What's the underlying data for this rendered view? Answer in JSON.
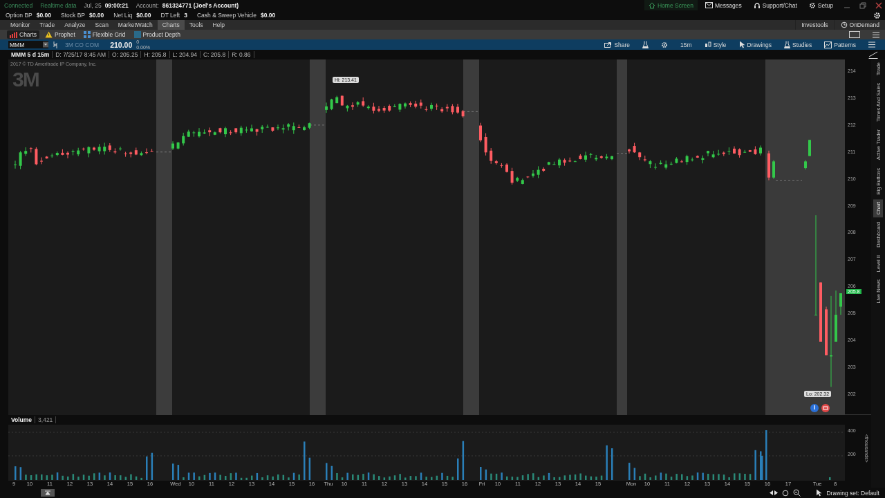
{
  "status_bar": {
    "connection": "Connected",
    "data_feed": "Realtime data",
    "date": "Jul, 25",
    "time": "09:00:21",
    "account_label": "Account:",
    "account": "861324771 (Joel's Account)"
  },
  "top_links": [
    {
      "label": "Home Screen",
      "kind": "home"
    },
    {
      "label": "Messages",
      "kind": "mail"
    },
    {
      "label": "Support/Chat",
      "kind": "headset"
    },
    {
      "label": "Setup",
      "kind": "gear"
    }
  ],
  "balances": [
    {
      "label": "Option BP",
      "value": "$0.00"
    },
    {
      "label": "Stock BP",
      "value": "$0.00"
    },
    {
      "label": "Net Liq",
      "value": "$0.00"
    },
    {
      "label": "DT Left",
      "value": "3"
    },
    {
      "label": "Cash & Sweep Vehicle",
      "value": "$0.00"
    }
  ],
  "main_tabs": [
    {
      "label": "Monitor",
      "selected": false
    },
    {
      "label": "Trade",
      "selected": false
    },
    {
      "label": "Analyze",
      "selected": false
    },
    {
      "label": "Scan",
      "selected": false
    },
    {
      "label": "MarketWatch",
      "selected": false
    },
    {
      "label": "Charts",
      "selected": true
    },
    {
      "label": "Tools",
      "selected": false
    },
    {
      "label": "Help",
      "selected": false
    }
  ],
  "right_links": [
    {
      "label": "Investools",
      "kind": "plain"
    },
    {
      "label": "OnDemand",
      "kind": "clock"
    }
  ],
  "sub_tabs": [
    {
      "label": "Charts",
      "kind": "bars",
      "selected": true
    },
    {
      "label": "Prophet",
      "kind": "warning",
      "selected": false
    },
    {
      "label": "Flexible Grid",
      "kind": "grid",
      "selected": false
    },
    {
      "label": "Product Depth",
      "kind": "depth",
      "selected": false
    }
  ],
  "symbol_bar": {
    "symbol": "MMM",
    "description": "3M CO COM",
    "last": "210.00",
    "change": "0",
    "change_pct": "0.00%"
  },
  "chart_tools": [
    {
      "label": "Share",
      "kind": "share"
    },
    {
      "kind": "flask"
    },
    {
      "kind": "gear"
    },
    {
      "label": "15m",
      "kind": "text"
    },
    {
      "label": "Style",
      "kind": "style"
    },
    {
      "label": "Drawings",
      "kind": "cursor"
    },
    {
      "label": "Studies",
      "kind": "flask"
    },
    {
      "label": "Patterns",
      "kind": "patterns"
    },
    {
      "kind": "menu"
    }
  ],
  "chart_header": {
    "title": "MMM 5 d 15m",
    "fields": [
      "D: 7/25/17 8:45 AM",
      "O: 205.25",
      "H: 205.8",
      "L: 204.94",
      "C: 205.8",
      "R: 0.86"
    ]
  },
  "price_chart": {
    "watermark": "2017 © TD Ameritrade IP Company, Inc.",
    "logo": "3M",
    "high_label": "Hi: 213.41",
    "low_label": "Lo: 202.32",
    "last_price": "205.8",
    "price_axis": [
      "214",
      "213",
      "212",
      "211",
      "210",
      "209",
      "208",
      "207",
      "206",
      "205",
      "204",
      "203",
      "202"
    ]
  },
  "side_tabs": [
    {
      "label": "Trade",
      "selected": false
    },
    {
      "label": "Times And Sales",
      "selected": false
    },
    {
      "label": "Active Trader",
      "selected": false
    },
    {
      "label": "Big Buttons",
      "selected": false
    },
    {
      "label": "Chart",
      "selected": true
    },
    {
      "label": "Dashboard",
      "selected": false
    },
    {
      "label": "Level II",
      "selected": false
    },
    {
      "label": "Live News",
      "selected": false
    }
  ],
  "volume": {
    "title": "Volume",
    "value": "3,421",
    "axis": [
      "400",
      "200"
    ],
    "unit": "<thousands>"
  },
  "time_axis": [
    [
      "9",
      "10",
      "11",
      "12",
      "13",
      "14",
      "15",
      "16"
    ],
    [
      "Wed",
      "10",
      "11",
      "12",
      "13",
      "14",
      "15",
      "16"
    ],
    [
      "Thu",
      "10",
      "11",
      "12",
      "13",
      "14",
      "15",
      "16"
    ],
    [
      "Fri",
      "10",
      "11",
      "12",
      "13",
      "14",
      "15"
    ],
    [
      "Mon",
      "10",
      "11",
      "12",
      "13",
      "14",
      "15",
      "16"
    ],
    [
      "17",
      "Tue",
      "8"
    ]
  ],
  "footer": {
    "drawing_set": "Drawing set: Default"
  }
}
